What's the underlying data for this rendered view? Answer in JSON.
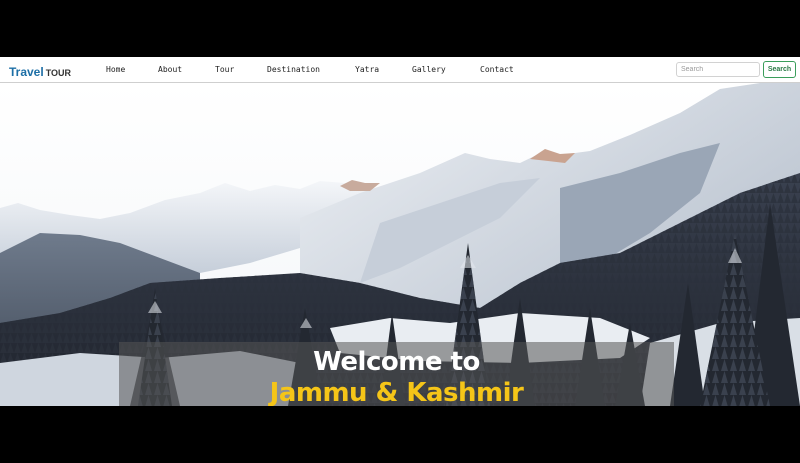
{
  "brand": {
    "primary": "Travel",
    "secondary": "TOUR"
  },
  "nav": {
    "items": [
      "Home",
      "About",
      "Tour",
      "Destination",
      "Yatra",
      "Gallery",
      "Contact"
    ]
  },
  "search": {
    "placeholder": "Search",
    "value": "",
    "button_label": "Search"
  },
  "hero": {
    "line1": "Welcome to",
    "line2": "Jammu & Kashmir",
    "line1_color": "#ffffff",
    "line2_color": "#f5c518"
  },
  "colors": {
    "brand": "#1d6fa6",
    "search_button": "#3a9d5a",
    "letterbox": "#000000"
  }
}
